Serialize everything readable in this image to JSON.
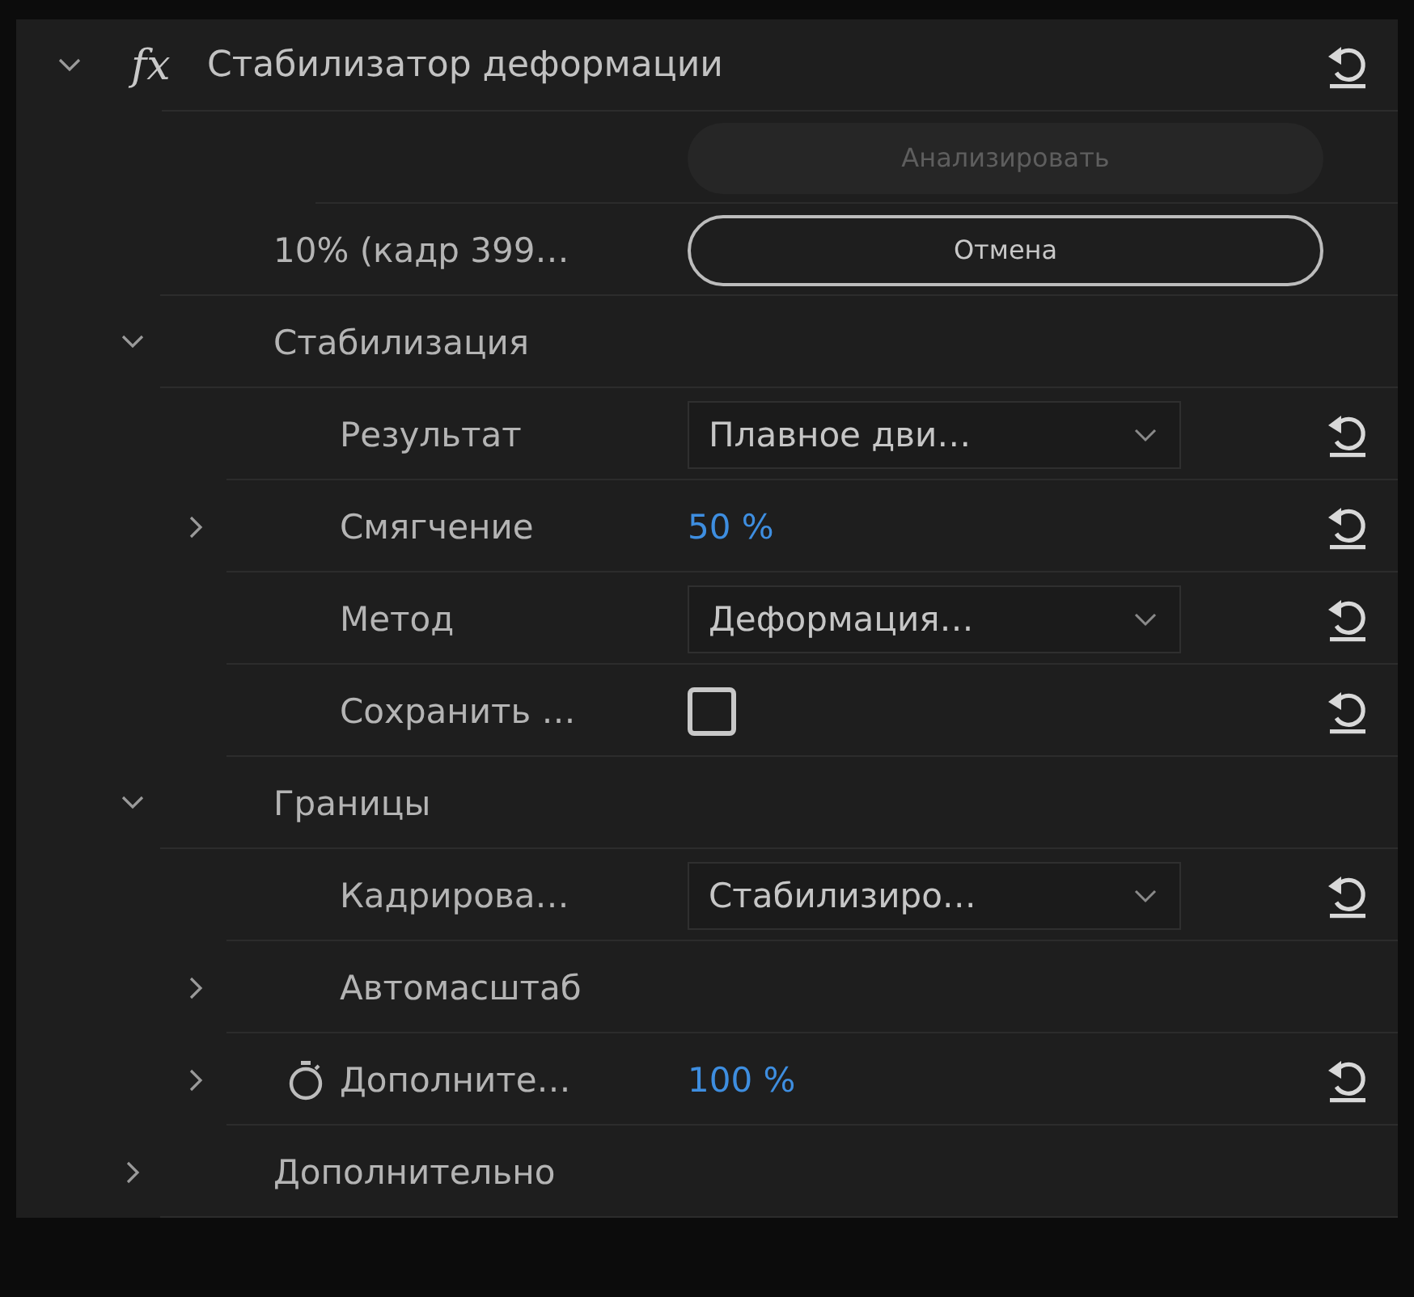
{
  "effect": {
    "icon_text": "fx",
    "title": "Стабилизатор деформации",
    "expanded": true,
    "reset": true,
    "children": [
      {
        "kind": "button",
        "label": "Анализировать",
        "disabled": true
      },
      {
        "kind": "progress",
        "label": "10% (кадр 399…",
        "button": "Отмена"
      },
      {
        "kind": "group",
        "label": "Стабилизация",
        "expanded": true,
        "children": [
          {
            "kind": "dropdown",
            "label": "Результат",
            "value": "Плавное дви…",
            "reset": true
          },
          {
            "kind": "value",
            "label": "Смягчение",
            "value": "50 %",
            "expanded": false,
            "stopwatch": false,
            "reset": true
          },
          {
            "kind": "dropdown",
            "label": "Метод",
            "value": "Деформация…",
            "reset": true
          },
          {
            "kind": "checkbox",
            "label": "Сохранить …",
            "checked": false,
            "reset": true
          }
        ]
      },
      {
        "kind": "group",
        "label": "Границы",
        "expanded": true,
        "children": [
          {
            "kind": "dropdown",
            "label": "Кадрирова…",
            "value": "Стабилизиро…",
            "reset": true
          },
          {
            "kind": "static",
            "label": "Автомасштаб",
            "expanded": false
          },
          {
            "kind": "value",
            "label": "Дополните…",
            "value": "100 %",
            "expanded": false,
            "stopwatch": true,
            "reset": true
          }
        ]
      },
      {
        "kind": "group",
        "label": "Дополнительно",
        "expanded": false
      }
    ]
  }
}
